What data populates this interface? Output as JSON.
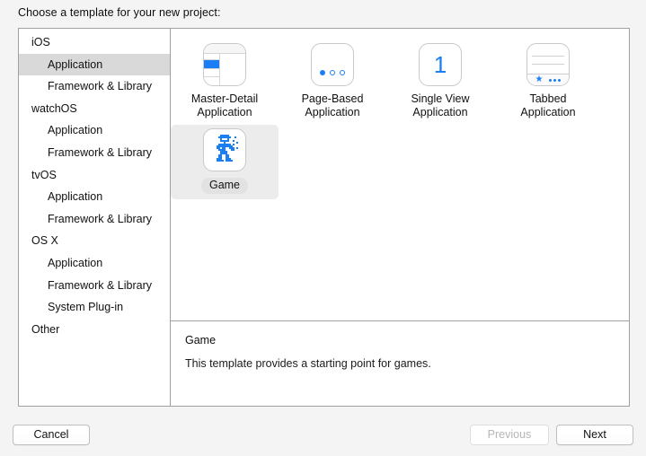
{
  "prompt": "Choose a template for your new project:",
  "sidebar": {
    "items": [
      {
        "label": "iOS",
        "level": 0,
        "selected": false
      },
      {
        "label": "Application",
        "level": 1,
        "selected": true
      },
      {
        "label": "Framework & Library",
        "level": 1,
        "selected": false
      },
      {
        "label": "watchOS",
        "level": 0,
        "selected": false
      },
      {
        "label": "Application",
        "level": 1,
        "selected": false
      },
      {
        "label": "Framework & Library",
        "level": 1,
        "selected": false
      },
      {
        "label": "tvOS",
        "level": 0,
        "selected": false
      },
      {
        "label": "Application",
        "level": 1,
        "selected": false
      },
      {
        "label": "Framework & Library",
        "level": 1,
        "selected": false
      },
      {
        "label": "OS X",
        "level": 0,
        "selected": false
      },
      {
        "label": "Application",
        "level": 1,
        "selected": false
      },
      {
        "label": "Framework & Library",
        "level": 1,
        "selected": false
      },
      {
        "label": "System Plug-in",
        "level": 1,
        "selected": false
      },
      {
        "label": "Other",
        "level": 0,
        "selected": false
      }
    ]
  },
  "templates": {
    "row1": [
      {
        "label": "Master-Detail\nApplication",
        "icon": "master-detail-icon",
        "selected": false
      },
      {
        "label": "Page-Based\nApplication",
        "icon": "page-based-icon",
        "selected": false
      },
      {
        "label": "Single View\nApplication",
        "icon": "single-view-icon",
        "selected": false
      },
      {
        "label": "Tabbed\nApplication",
        "icon": "tabbed-icon",
        "selected": false
      }
    ],
    "row2": [
      {
        "label": "Game",
        "icon": "game-sprite-icon",
        "selected": true
      }
    ],
    "single_view_numeral": "1"
  },
  "description": {
    "title": "Game",
    "body": "This template provides a starting point for games."
  },
  "footer": {
    "cancel_label": "Cancel",
    "previous_label": "Previous",
    "next_label": "Next",
    "previous_disabled": true
  },
  "colors": {
    "accent_blue": "#1a7ef5",
    "selection_gray": "#d9d9d9",
    "panel_border": "#a0a0a0",
    "window_bg": "#f4f4f4"
  }
}
